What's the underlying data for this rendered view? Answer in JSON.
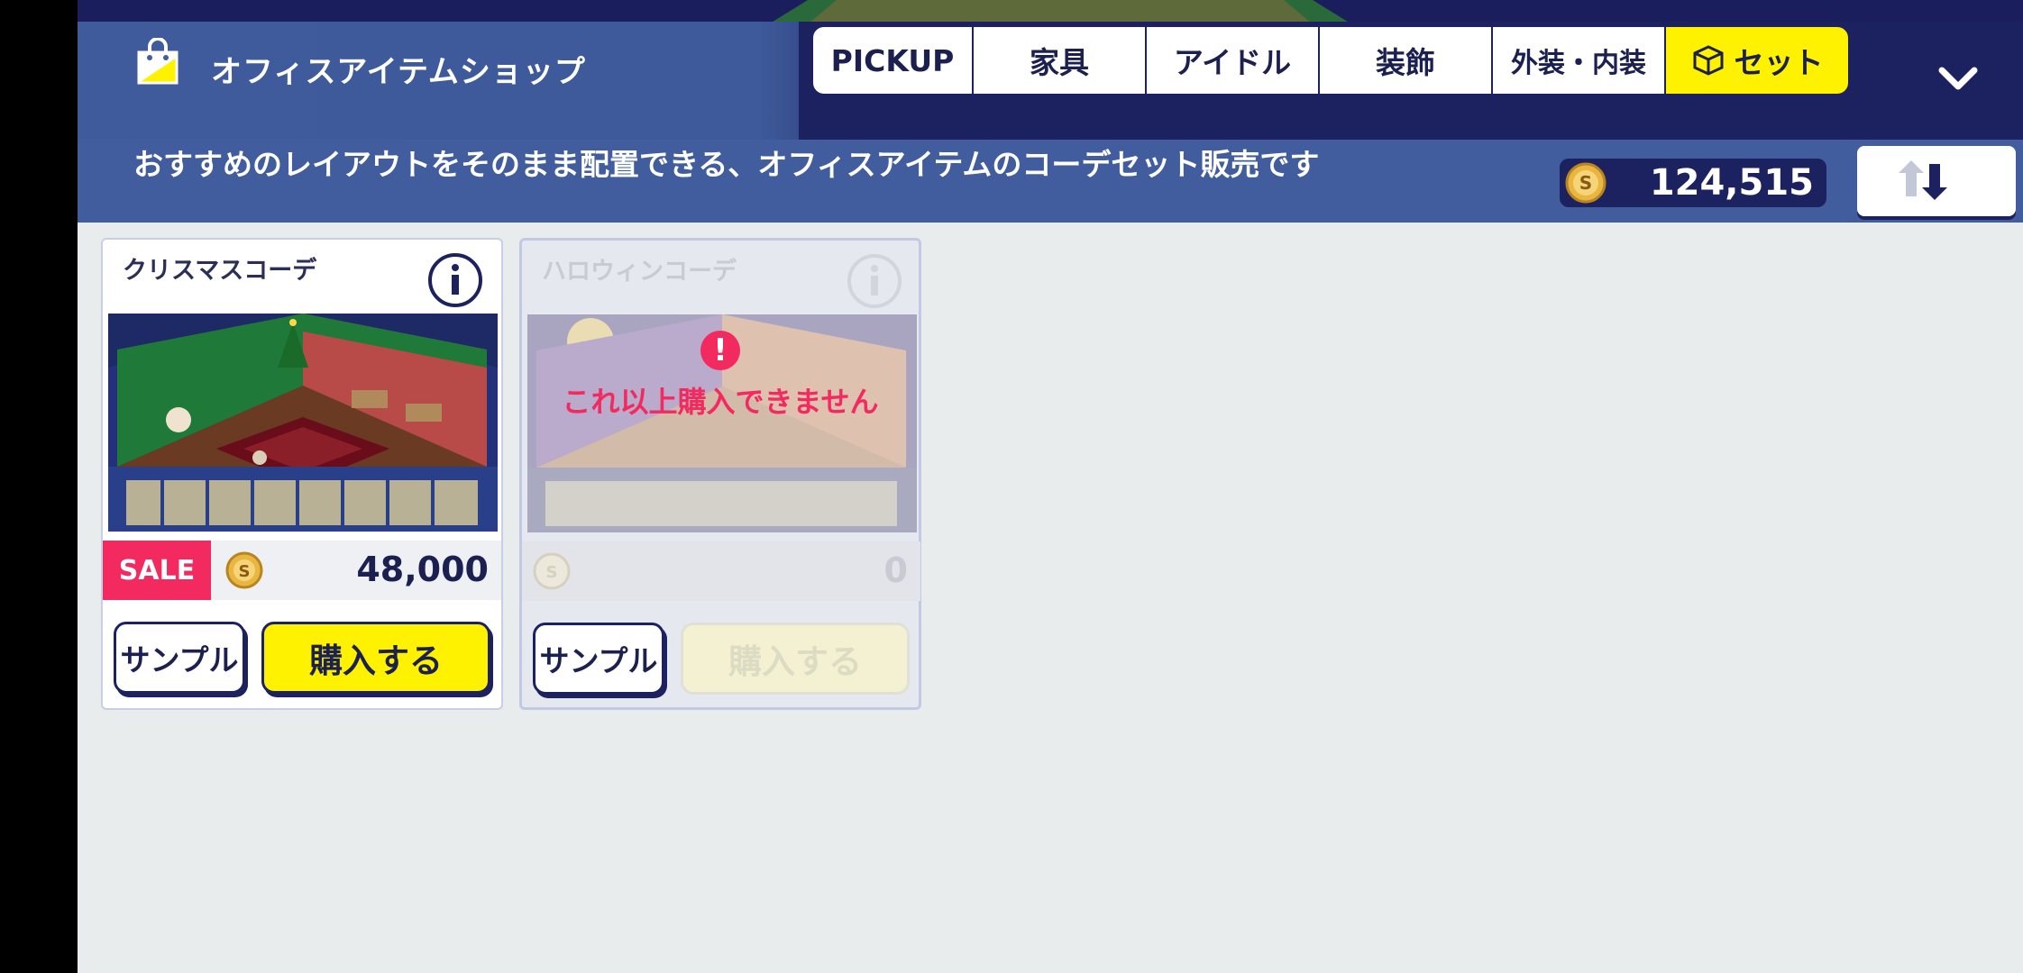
{
  "shop": {
    "title": "オフィスアイテムショップ",
    "description": "おすすめのレイアウトをそのまま配置できる、オフィスアイテムのコーデセット販売です",
    "coins": "124,515"
  },
  "tabs": [
    {
      "label": "PICKUP"
    },
    {
      "label": "家具"
    },
    {
      "label": "アイドル"
    },
    {
      "label": "装飾"
    },
    {
      "label": "外装・内装"
    },
    {
      "label": "セット",
      "active": true
    }
  ],
  "items": [
    {
      "title": "クリスマスコーデ",
      "badge": "SALE",
      "price": "48,000",
      "sample_label": "サンプル",
      "buy_label": "購入する"
    },
    {
      "title": "ハロウィンコーデ",
      "price": "0",
      "sample_label": "サンプル",
      "buy_label": "購入する",
      "warning": "これ以上購入できません"
    }
  ],
  "colors": {
    "accent": "#fff200",
    "navy": "#1c2160",
    "sale": "#f32a60"
  }
}
